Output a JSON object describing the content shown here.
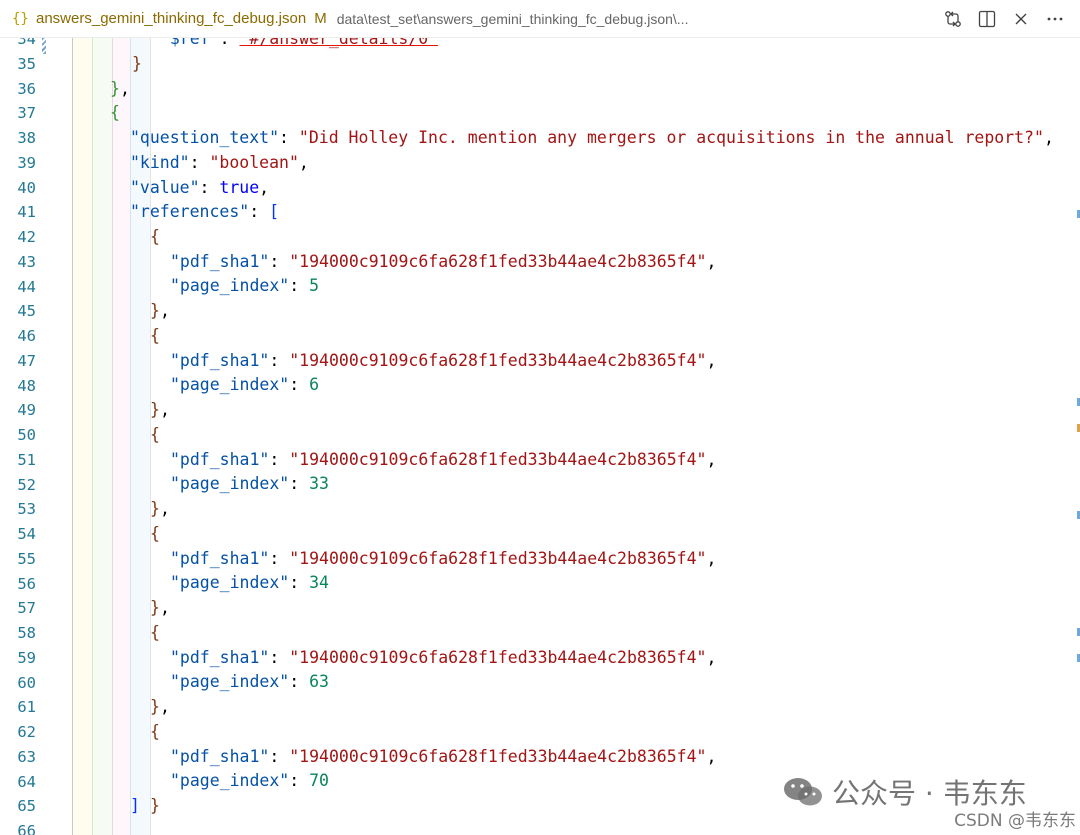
{
  "tab": {
    "icon": "{}",
    "file_name": "answers_gemini_thinking_fc_debug.json",
    "modified_marker": "M",
    "path": "data\\test_set\\answers_gemini_thinking_fc_debug.json\\..."
  },
  "actions": [
    {
      "name": "compare-changes-icon"
    },
    {
      "name": "split-editor-icon"
    },
    {
      "name": "close-icon"
    },
    {
      "name": "more-actions-icon"
    }
  ],
  "colors": {
    "key": "#0451a5",
    "string": "#a31515",
    "number": "#098658",
    "keyword": "#0000ff",
    "line_number": "#237893",
    "bracket_level_1": "#0431fa",
    "bracket_level_2": "#319331",
    "bracket_level_3": "#7b3814"
  },
  "code": {
    "line_numbers": [
      "34",
      "35",
      "36",
      "37",
      "38",
      "39",
      "40",
      "41",
      "42",
      "43",
      "44",
      "45",
      "46",
      "47",
      "48",
      "49",
      "50",
      "51",
      "52",
      "53",
      "54",
      "55",
      "56",
      "57",
      "58",
      "59",
      "60",
      "61",
      "62",
      "63",
      "64",
      "65",
      "66"
    ],
    "ref_line": {
      "key": "\"$ref\"",
      "value": "\"#/answer_details/0\""
    },
    "question": {
      "key": "\"question_text\"",
      "value": "\"Did Holley Inc. mention any mergers or acquisitions in the annual report?\""
    },
    "kind": {
      "key": "\"kind\"",
      "value": "\"boolean\""
    },
    "value": {
      "key": "\"value\"",
      "value": "true"
    },
    "references_key": "\"references\"",
    "references": [
      {
        "sha_key": "\"pdf_sha1\"",
        "sha": "\"194000c9109c6fa628f1fed33b44ae4c2b8365f4\"",
        "idx_key": "\"page_index\"",
        "idx": "5"
      },
      {
        "sha_key": "\"pdf_sha1\"",
        "sha": "\"194000c9109c6fa628f1fed33b44ae4c2b8365f4\"",
        "idx_key": "\"page_index\"",
        "idx": "6"
      },
      {
        "sha_key": "\"pdf_sha1\"",
        "sha": "\"194000c9109c6fa628f1fed33b44ae4c2b8365f4\"",
        "idx_key": "\"page_index\"",
        "idx": "33"
      },
      {
        "sha_key": "\"pdf_sha1\"",
        "sha": "\"194000c9109c6fa628f1fed33b44ae4c2b8365f4\"",
        "idx_key": "\"page_index\"",
        "idx": "34"
      },
      {
        "sha_key": "\"pdf_sha1\"",
        "sha": "\"194000c9109c6fa628f1fed33b44ae4c2b8365f4\"",
        "idx_key": "\"page_index\"",
        "idx": "63"
      },
      {
        "sha_key": "\"pdf_sha1\"",
        "sha": "\"194000c9109c6fa628f1fed33b44ae4c2b8365f4\"",
        "idx_key": "\"page_index\"",
        "idx": "70"
      }
    ]
  },
  "watermark": {
    "main_text": "公众号 · 韦东东",
    "sub_text": "CSDN @韦东东"
  }
}
